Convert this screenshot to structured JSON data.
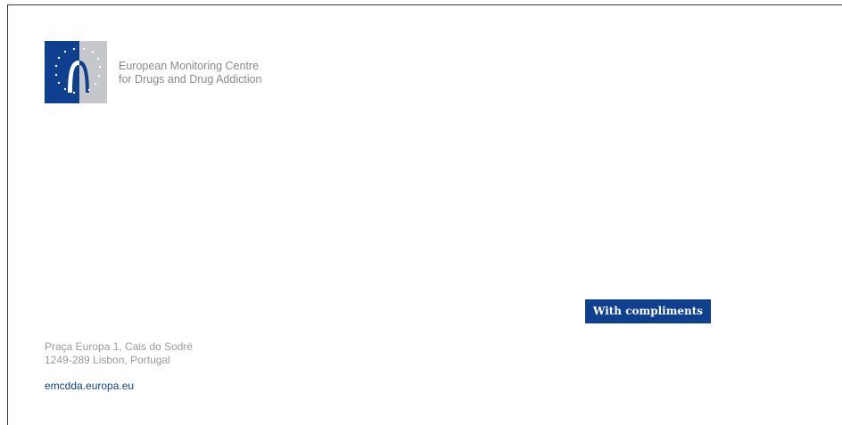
{
  "logo": {
    "icon": "emcdda-logo-icon",
    "colors": {
      "blue": "#0f3f8f",
      "grey": "#c6c7ca",
      "star": "#f5cf1f"
    }
  },
  "organization": {
    "line1": "European Monitoring Centre",
    "line2": "for Drugs and Drug Addiction"
  },
  "badge": {
    "label": "With compliments",
    "color": "#0f3f8f"
  },
  "address": {
    "line1": "Praça Europa 1, Cais do Sodré",
    "line2": "1249-289 Lisbon, Portugal"
  },
  "website": "emcdda.europa.eu"
}
